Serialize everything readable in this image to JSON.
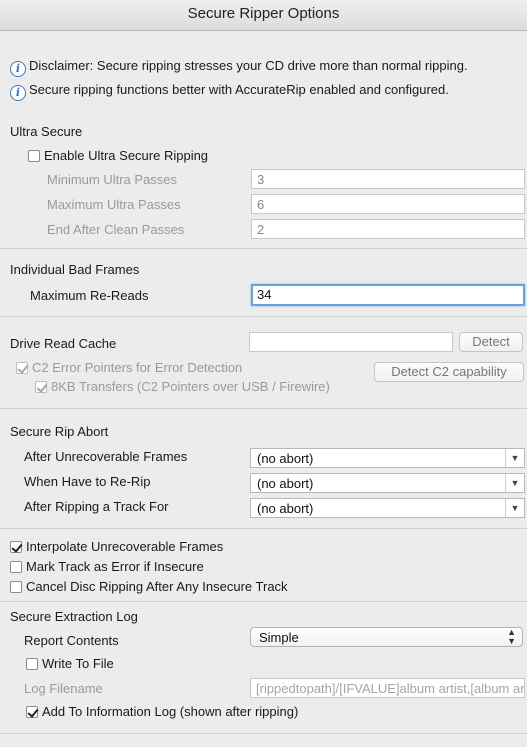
{
  "window": {
    "title": "Secure Ripper Options"
  },
  "notes": {
    "disclaimer": "Disclaimer: Secure ripping stresses your CD drive more than normal ripping.",
    "accuraterip": "Secure ripping functions better with AccurateRip enabled and configured."
  },
  "ultra": {
    "heading": "Ultra Secure",
    "enable_label": "Enable Ultra Secure Ripping",
    "min_label": "Minimum Ultra Passes",
    "min_value": "3",
    "max_label": "Maximum Ultra Passes",
    "max_value": "6",
    "clean_label": "End After Clean Passes",
    "clean_value": "2"
  },
  "bad_frames": {
    "heading": "Individual Bad Frames",
    "rereads_label": "Maximum Re-Reads",
    "rereads_value": "34"
  },
  "cache": {
    "label": "Drive Read Cache",
    "value": "",
    "detect_label": "Detect",
    "c2_label": "C2 Error Pointers for Error Detection",
    "transfers_label": "8KB Transfers (C2 Pointers over USB / Firewire)",
    "detect_c2_label": "Detect C2 capability"
  },
  "abort": {
    "heading": "Secure Rip Abort",
    "unrecoverable_label": "After Unrecoverable Frames",
    "unrecoverable_value": "(no abort)",
    "rerip_label": "When Have to Re-Rip",
    "rerip_value": "(no abort)",
    "track_label": "After Ripping a Track For",
    "track_value": "(no abort)"
  },
  "options": {
    "interpolate": "Interpolate Unrecoverable Frames",
    "mark_error": "Mark Track as Error if Insecure",
    "cancel_disc": "Cancel Disc Ripping After Any Insecure Track"
  },
  "log": {
    "heading": "Secure Extraction Log",
    "report_label": "Report Contents",
    "report_value": "Simple",
    "write_label": "Write To File",
    "filename_label": "Log Filename",
    "filename_value": "[rippedtopath]/[IFVALUE]album artist,[album artist]",
    "add_info_label": "Add To Information Log (shown after ripping)"
  }
}
